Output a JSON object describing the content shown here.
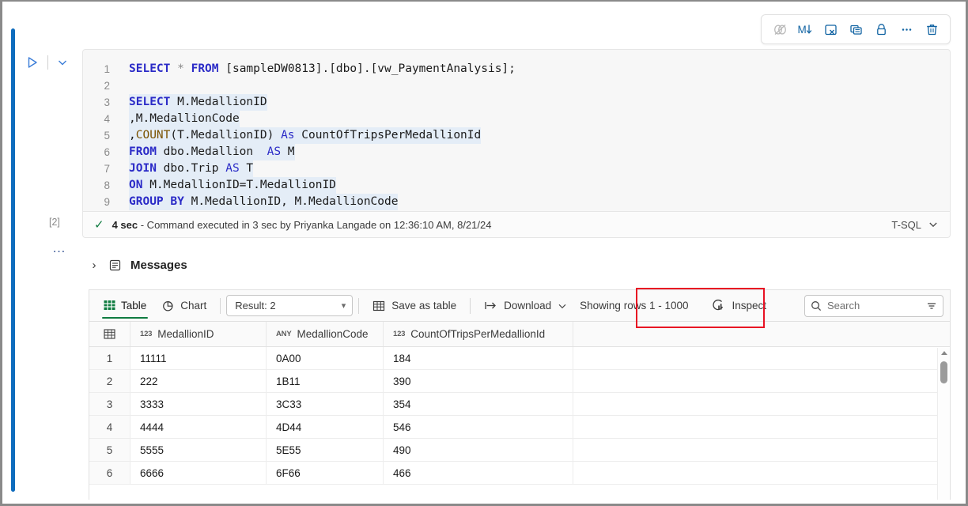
{
  "cell": {
    "execution_index": "[2]",
    "more_options": "…",
    "language": "T-SQL",
    "run_icon": "play-icon",
    "run_options_icon": "chevron-down-icon"
  },
  "toolbar": {
    "buttons": [
      {
        "name": "toggle-cell-icon",
        "title": "Hide input"
      },
      {
        "name": "convert-markdown-icon",
        "title": "M↓"
      },
      {
        "name": "clear-output-icon",
        "title": "Clear output"
      },
      {
        "name": "duplicate-cell-icon",
        "title": "Duplicate"
      },
      {
        "name": "lock-cell-icon",
        "title": "Lock"
      },
      {
        "name": "more-options-icon",
        "title": "More"
      },
      {
        "name": "delete-cell-icon",
        "title": "Delete"
      }
    ]
  },
  "editor": {
    "lines": [
      {
        "num": "1",
        "highlight": false,
        "tokens": [
          {
            "t": "SELECT",
            "c": "kw"
          },
          {
            "t": " ",
            "c": "pl"
          },
          {
            "t": "*",
            "c": "op"
          },
          {
            "t": " ",
            "c": "pl"
          },
          {
            "t": "FROM",
            "c": "kw"
          },
          {
            "t": " [sampleDW0813].[dbo].[vw_PaymentAnalysis];",
            "c": "pl"
          }
        ]
      },
      {
        "num": "2",
        "highlight": false,
        "tokens": []
      },
      {
        "num": "3",
        "highlight": true,
        "tokens": [
          {
            "t": "SELECT",
            "c": "kw"
          },
          {
            "t": " M.MedallionID",
            "c": "pl"
          }
        ]
      },
      {
        "num": "4",
        "highlight": true,
        "tokens": [
          {
            "t": ",M.MedallionCode",
            "c": "pl"
          }
        ]
      },
      {
        "num": "5",
        "highlight": true,
        "tokens": [
          {
            "t": ",",
            "c": "pl"
          },
          {
            "t": "COUNT",
            "c": "fn"
          },
          {
            "t": "(T.MedallionID) ",
            "c": "pl"
          },
          {
            "t": "As",
            "c": "kw2"
          },
          {
            "t": " CountOfTripsPerMedallionId",
            "c": "pl"
          }
        ]
      },
      {
        "num": "6",
        "highlight": true,
        "tokens": [
          {
            "t": "FROM",
            "c": "kw"
          },
          {
            "t": " dbo.Medallion  ",
            "c": "pl"
          },
          {
            "t": "AS",
            "c": "kw2"
          },
          {
            "t": " M",
            "c": "pl"
          }
        ]
      },
      {
        "num": "7",
        "highlight": true,
        "tokens": [
          {
            "t": "JOIN",
            "c": "kw"
          },
          {
            "t": " dbo.Trip ",
            "c": "pl"
          },
          {
            "t": "AS",
            "c": "kw2"
          },
          {
            "t": " T",
            "c": "pl"
          }
        ]
      },
      {
        "num": "8",
        "highlight": true,
        "tokens": [
          {
            "t": "ON",
            "c": "kw"
          },
          {
            "t": " M.MedallionID=T.MedallionID",
            "c": "pl"
          }
        ]
      },
      {
        "num": "9",
        "highlight": true,
        "tokens": [
          {
            "t": "GROUP",
            "c": "kw"
          },
          {
            "t": " ",
            "c": "pl"
          },
          {
            "t": "BY",
            "c": "kw"
          },
          {
            "t": " M.MedallionID, M.MedallionCode",
            "c": "pl"
          }
        ]
      }
    ]
  },
  "execution": {
    "status_icon": "checkmark-icon",
    "duration": "4 sec",
    "message": " - Command executed in 3 sec by Priyanka Langade on 12:36:10 AM, 8/21/24"
  },
  "messages": {
    "expand_icon": "chevron-right-icon",
    "doc_icon": "messages-icon",
    "label": "Messages"
  },
  "results": {
    "tabs": [
      {
        "label": "Table",
        "icon": "table-grid-icon",
        "active": true
      },
      {
        "label": "Chart",
        "icon": "pie-chart-icon",
        "active": false
      }
    ],
    "result_select": {
      "value": "Result: 2",
      "chevron": "chevron-down-icon"
    },
    "save_as_table": {
      "label": "Save as table",
      "icon": "table-icon",
      "highlight_color": "#e81123"
    },
    "download": {
      "label": "Download",
      "icon": "download-icon",
      "chevron": "chevron-down-icon"
    },
    "showing_rows": "Showing rows 1 - 1000",
    "inspect": {
      "label": "Inspect",
      "icon": "inspect-icon"
    },
    "search": {
      "placeholder": "Search",
      "icon": "search-icon",
      "filter_icon": "filter-icon"
    }
  },
  "grid": {
    "rownum_header_icon": "table-header-icon",
    "columns": [
      {
        "name": "MedallionID",
        "type": "123"
      },
      {
        "name": "MedallionCode",
        "type": "ANY"
      },
      {
        "name": "CountOfTripsPerMedallionId",
        "type": "123"
      }
    ],
    "rows": [
      {
        "n": "1",
        "cells": [
          "11111",
          "0A00",
          "184"
        ]
      },
      {
        "n": "2",
        "cells": [
          "222",
          "1B11",
          "390"
        ]
      },
      {
        "n": "3",
        "cells": [
          "3333",
          "3C33",
          "354"
        ]
      },
      {
        "n": "4",
        "cells": [
          "4444",
          "4D44",
          "546"
        ]
      },
      {
        "n": "5",
        "cells": [
          "5555",
          "5E55",
          "490"
        ]
      },
      {
        "n": "6",
        "cells": [
          "6666",
          "6F66",
          "466"
        ]
      }
    ]
  },
  "colors": {
    "accent_blue": "#0f6cbd",
    "tab_green": "#107c41",
    "annotation_red": "#e81123"
  }
}
